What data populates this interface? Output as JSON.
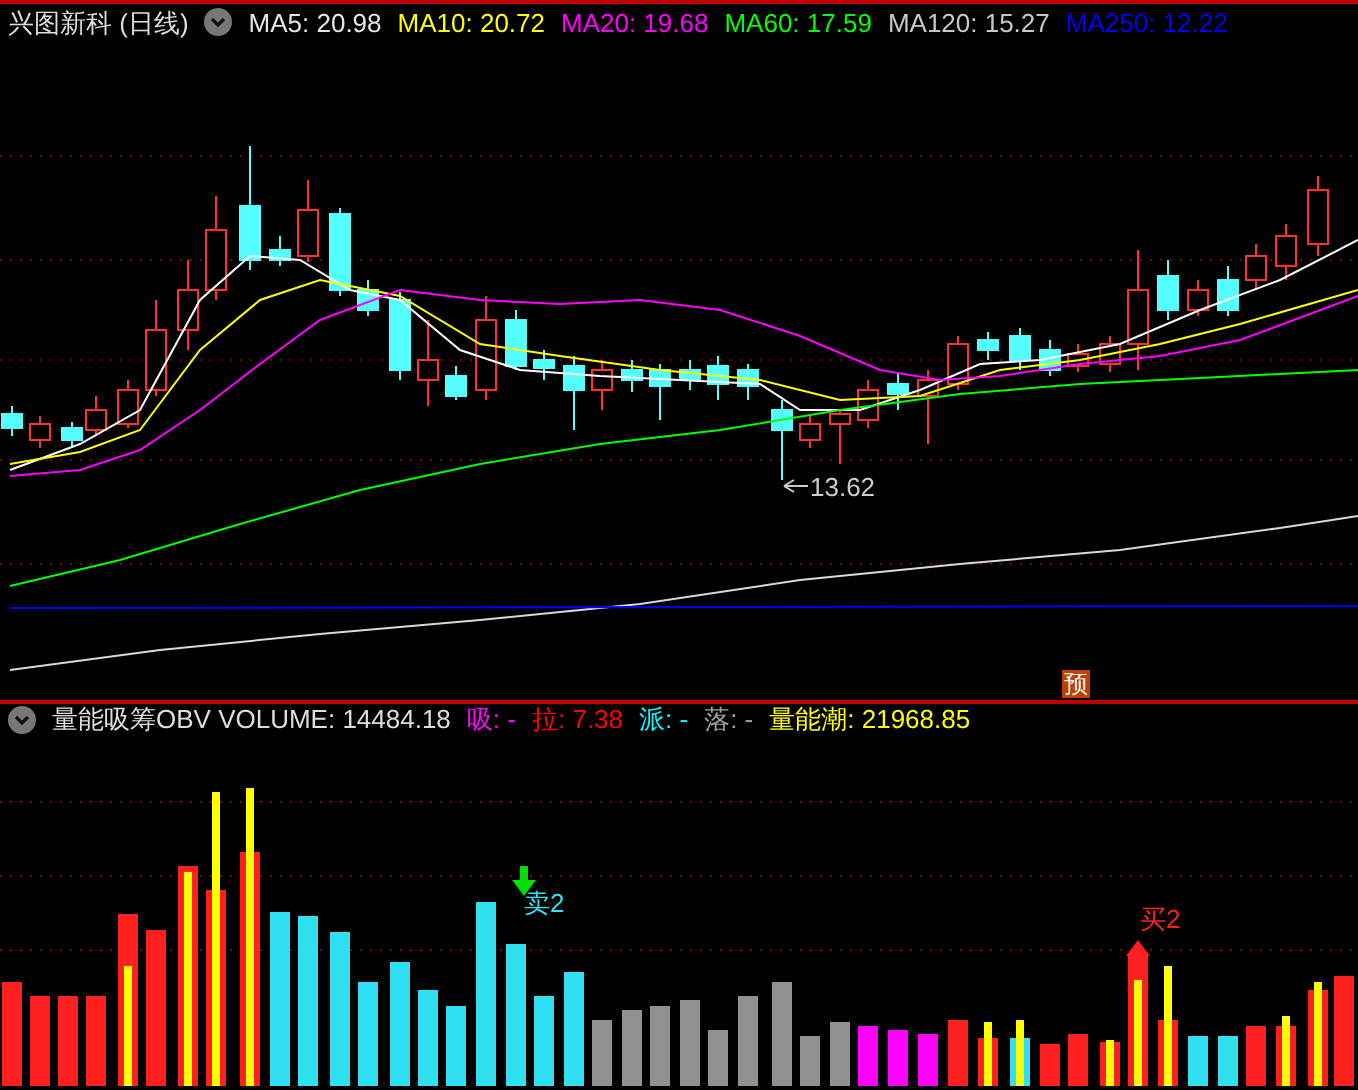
{
  "header": {
    "title": "兴图新科 (日线)",
    "indicators": [
      {
        "text": "MA5: 20.98",
        "color": "#e6e6e6"
      },
      {
        "text": "MA10: 20.72",
        "color": "#ffff00"
      },
      {
        "text": "MA20: 19.68",
        "color": "#ff00ff"
      },
      {
        "text": "MA60: 17.59",
        "color": "#00ff00"
      },
      {
        "text": "MA120: 15.27",
        "color": "#c8c8c8"
      },
      {
        "text": "MA250: 12.22",
        "color": "#0000ff"
      }
    ]
  },
  "price_chart": {
    "low_label": "13.62",
    "forecast_badge": "预"
  },
  "volume_header": {
    "title": "量能吸筹OBV VOLUME: 14484.18",
    "indicators": [
      {
        "text": "吸: -",
        "color": "#ff00ff"
      },
      {
        "text": "拉: 7.38",
        "color": "#ff0000"
      },
      {
        "text": "派: -",
        "color": "#00ffff"
      },
      {
        "text": "落: -",
        "color": "#a0a0a0"
      },
      {
        "text": "量能潮: 21968.85",
        "color": "#ffff00"
      }
    ]
  },
  "volume_chart": {
    "signals": [
      {
        "label": "卖2",
        "kind": "sell"
      },
      {
        "label": "买2",
        "kind": "buy"
      }
    ]
  }
}
